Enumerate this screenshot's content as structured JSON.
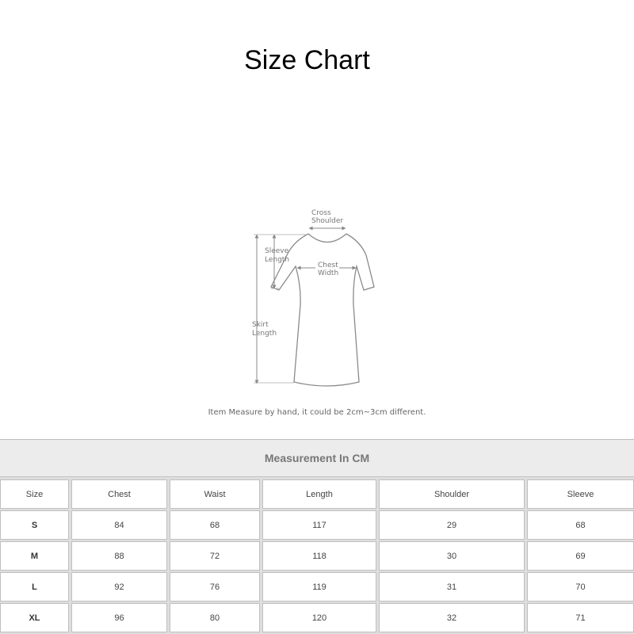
{
  "title": "Size Chart",
  "diagram": {
    "labels": {
      "cross_shoulder": [
        "Cross",
        "Shoulder"
      ],
      "sleeve_length": [
        "Sleeve",
        "Length"
      ],
      "chest_width": [
        "Chest",
        "Width"
      ],
      "skirt_length": [
        "Skirt",
        "Length"
      ]
    },
    "note": "Item Measure by hand, it could be 2cm~3cm different."
  },
  "table": {
    "caption": "Measurement In CM",
    "headers": [
      "Size",
      "Chest",
      "Waist",
      "Length",
      "Shoulder",
      "Sleeve"
    ],
    "rows": [
      [
        "S",
        "84",
        "68",
        "117",
        "29",
        "68"
      ],
      [
        "M",
        "88",
        "72",
        "118",
        "30",
        "69"
      ],
      [
        "L",
        "92",
        "76",
        "119",
        "31",
        "70"
      ],
      [
        "XL",
        "96",
        "80",
        "120",
        "32",
        "71"
      ]
    ]
  }
}
